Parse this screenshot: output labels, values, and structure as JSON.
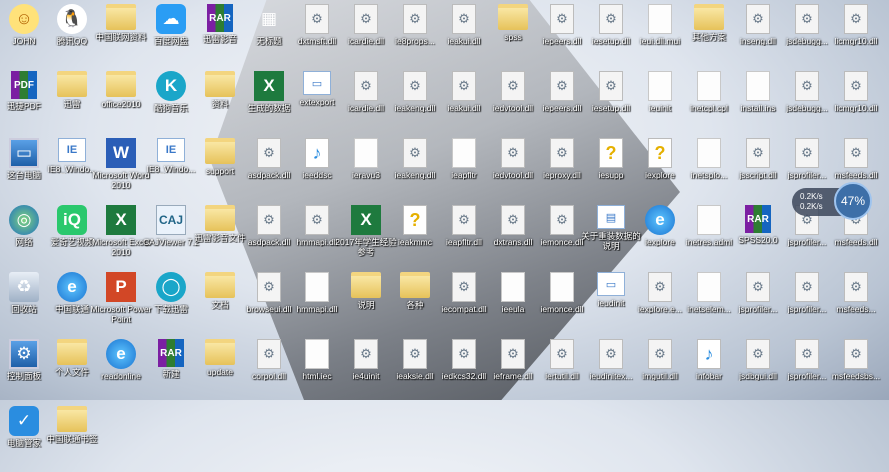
{
  "columns": [
    [
      {
        "label": "JOHN",
        "kind": "user",
        "glyph": "☺",
        "icon": "user-folder-icon"
      },
      {
        "label": "迅捷PDF",
        "kind": "rar",
        "glyph": "PDF",
        "icon": "pdf-converter-icon"
      },
      {
        "label": "这台电脑",
        "kind": "computer",
        "glyph": "▭",
        "icon": "computer-icon"
      },
      {
        "label": "网络",
        "kind": "globe",
        "glyph": "◎",
        "icon": "network-icon"
      },
      {
        "label": "回收站",
        "kind": "trash",
        "glyph": "♻",
        "icon": "recycle-bin-icon"
      },
      {
        "label": "控制面板",
        "kind": "computer",
        "glyph": "⚙",
        "icon": "control-panel-icon"
      },
      {
        "label": "电脑管家",
        "kind": "blue",
        "glyph": "✓",
        "icon": "pc-manager-icon"
      }
    ],
    [
      {
        "label": "腾讯QQ",
        "kind": "qq",
        "glyph": "🐧",
        "icon": "qq-icon"
      },
      {
        "label": "迅雷",
        "kind": "folder",
        "glyph": "",
        "icon": "folder-icon"
      },
      {
        "label": "IE8_Windo...",
        "kind": "exe",
        "glyph": "IE",
        "icon": "installer-icon"
      },
      {
        "label": "爱奇艺视频",
        "kind": "green",
        "glyph": "iQ",
        "icon": "iqiyi-icon"
      },
      {
        "label": "中国联通",
        "kind": "ie",
        "glyph": "e",
        "icon": "ie-icon"
      },
      {
        "label": "个人文件",
        "kind": "folder",
        "glyph": "",
        "icon": "folder-icon"
      },
      {
        "label": "中国联通书签",
        "kind": "folder",
        "glyph": "",
        "icon": "folder-icon"
      }
    ],
    [
      {
        "label": "中国联网资料",
        "kind": "folder",
        "glyph": "",
        "icon": "folder-icon"
      },
      {
        "label": "office2010",
        "kind": "folder",
        "glyph": "",
        "icon": "folder-icon"
      },
      {
        "label": "Microsoft Word 2010",
        "kind": "word",
        "glyph": "W",
        "icon": "word-icon"
      },
      {
        "label": "Microsoft Excel 2010",
        "kind": "excel",
        "glyph": "X",
        "icon": "excel-icon"
      },
      {
        "label": "Microsoft PowerPoint",
        "kind": "ppt",
        "glyph": "P",
        "icon": "powerpoint-icon"
      },
      {
        "label": "readonline",
        "kind": "ie",
        "glyph": "e",
        "icon": "ie-icon"
      }
    ],
    [
      {
        "label": "百度网盘",
        "kind": "cloud",
        "glyph": "☁",
        "icon": "baidu-netdisk-icon"
      },
      {
        "label": "酷狗音乐",
        "kind": "teal",
        "glyph": "K",
        "icon": "kugou-icon"
      },
      {
        "label": "IE8_Windo...",
        "kind": "exe",
        "glyph": "IE",
        "icon": "installer-icon"
      },
      {
        "label": "CAJViewer 7.2",
        "kind": "plain",
        "glyph": "CAJ",
        "icon": "cajviewer-icon"
      },
      {
        "label": "下载迅雷",
        "kind": "teal",
        "glyph": "◯",
        "icon": "download-icon"
      },
      {
        "label": "新建",
        "kind": "rar",
        "glyph": "RAR",
        "icon": "winrar-icon"
      }
    ],
    [
      {
        "label": "迅雷影音",
        "kind": "rar",
        "glyph": "RAR",
        "icon": "winrar-icon"
      },
      {
        "label": "资料",
        "kind": "folder",
        "glyph": "",
        "icon": "folder-icon"
      },
      {
        "label": "support",
        "kind": "folder",
        "glyph": "",
        "icon": "folder-icon"
      },
      {
        "label": "迅雷影音文件",
        "kind": "folder",
        "glyph": "",
        "icon": "folder-icon"
      },
      {
        "label": "文档",
        "kind": "folder",
        "glyph": "",
        "icon": "folder-icon"
      },
      {
        "label": "update",
        "kind": "folder",
        "glyph": "",
        "icon": "folder-icon"
      }
    ],
    [
      {
        "label": "无标题",
        "kind": "app",
        "glyph": "▦",
        "icon": "table-app-icon"
      },
      {
        "label": "生成的数据",
        "kind": "excel",
        "glyph": "X",
        "icon": "excel-file-icon"
      },
      {
        "label": "asdpack.dll",
        "kind": "dll",
        "glyph": "⚙",
        "icon": "dll-file-icon"
      },
      {
        "label": "asdpack.dll",
        "kind": "dll",
        "glyph": "⚙",
        "icon": "dll-file-icon"
      },
      {
        "label": "browseui.dll",
        "kind": "dll",
        "glyph": "⚙",
        "icon": "dll-file-icon"
      },
      {
        "label": "corpol.dll",
        "kind": "dll",
        "glyph": "⚙",
        "icon": "dll-file-icon"
      }
    ],
    [
      {
        "label": "dxtmsft.dll",
        "kind": "dll",
        "glyph": "⚙",
        "icon": "dll-file-icon"
      },
      {
        "label": "extexport",
        "kind": "exe",
        "glyph": "▭",
        "icon": "exe-file-icon"
      },
      {
        "label": "ieeddsc",
        "kind": "media",
        "glyph": "♪",
        "icon": "media-file-icon"
      },
      {
        "label": "hmmapi.dll",
        "kind": "dll",
        "glyph": "⚙",
        "icon": "dll-file-icon"
      },
      {
        "label": "hmmapi.dll",
        "kind": "doc",
        "glyph": "",
        "icon": "file-icon"
      },
      {
        "label": "html.iec",
        "kind": "doc",
        "glyph": "",
        "icon": "file-icon"
      }
    ],
    [
      {
        "label": "icardie.dll",
        "kind": "dll",
        "glyph": "⚙",
        "icon": "dll-file-icon"
      },
      {
        "label": "icardie.dll",
        "kind": "dll",
        "glyph": "⚙",
        "icon": "dll-file-icon"
      },
      {
        "label": "ieravu3",
        "kind": "doc",
        "glyph": "",
        "icon": "file-icon"
      },
      {
        "label": "2017年学生经验参考",
        "kind": "excel",
        "glyph": "X",
        "icon": "excel-file-icon"
      },
      {
        "label": "说明",
        "kind": "folder",
        "glyph": "",
        "icon": "folder-icon"
      },
      {
        "label": "ie4uinit",
        "kind": "dll",
        "glyph": "⚙",
        "icon": "dll-file-icon"
      }
    ],
    [
      {
        "label": "ie8props...",
        "kind": "dll",
        "glyph": "⚙",
        "icon": "dll-file-icon"
      },
      {
        "label": "ieakeng.dll",
        "kind": "dll",
        "glyph": "⚙",
        "icon": "dll-file-icon"
      },
      {
        "label": "ieakeng.dll",
        "kind": "dll",
        "glyph": "⚙",
        "icon": "dll-file-icon"
      },
      {
        "label": "ieakmmc",
        "kind": "help",
        "glyph": "?",
        "icon": "help-file-icon"
      },
      {
        "label": "各种",
        "kind": "folder",
        "glyph": "",
        "icon": "folder-icon"
      },
      {
        "label": "ieaksie.dll",
        "kind": "dll",
        "glyph": "⚙",
        "icon": "dll-file-icon"
      }
    ],
    [
      {
        "label": "ieakui.dll",
        "kind": "dll",
        "glyph": "⚙",
        "icon": "dll-file-icon"
      },
      {
        "label": "ieakui.dll",
        "kind": "dll",
        "glyph": "⚙",
        "icon": "dll-file-icon"
      },
      {
        "label": "ieapfltr",
        "kind": "doc",
        "glyph": "",
        "icon": "file-icon"
      },
      {
        "label": "ieapfltr.dll",
        "kind": "dll",
        "glyph": "⚙",
        "icon": "dll-file-icon"
      },
      {
        "label": "iecompat.dll",
        "kind": "dll",
        "glyph": "⚙",
        "icon": "dll-file-icon"
      },
      {
        "label": "iedkcs32.dll",
        "kind": "dll",
        "glyph": "⚙",
        "icon": "dll-file-icon"
      }
    ],
    [
      {
        "label": "spss",
        "kind": "folder",
        "glyph": "",
        "icon": "folder-icon"
      },
      {
        "label": "iedvtool.dll",
        "kind": "dll",
        "glyph": "⚙",
        "icon": "dll-file-icon"
      },
      {
        "label": "iedvtool.dll",
        "kind": "dll",
        "glyph": "⚙",
        "icon": "dll-file-icon"
      },
      {
        "label": "dxtrans.dll",
        "kind": "dll",
        "glyph": "⚙",
        "icon": "dll-file-icon"
      },
      {
        "label": "ieeula",
        "kind": "doc",
        "glyph": "",
        "icon": "file-icon"
      },
      {
        "label": "ieframe.dll",
        "kind": "dll",
        "glyph": "⚙",
        "icon": "dll-file-icon"
      }
    ],
    [
      {
        "label": "iepeers.dll",
        "kind": "dll",
        "glyph": "⚙",
        "icon": "dll-file-icon"
      },
      {
        "label": "iepeers.dll",
        "kind": "dll",
        "glyph": "⚙",
        "icon": "dll-file-icon"
      },
      {
        "label": "ieproxy.dll",
        "kind": "dll",
        "glyph": "⚙",
        "icon": "dll-file-icon"
      },
      {
        "label": "iemonce.dll",
        "kind": "dll",
        "glyph": "⚙",
        "icon": "dll-file-icon"
      },
      {
        "label": "iemonce.dll",
        "kind": "doc",
        "glyph": "",
        "icon": "file-icon"
      },
      {
        "label": "iertutil.dll",
        "kind": "dll",
        "glyph": "⚙",
        "icon": "dll-file-icon"
      }
    ],
    [
      {
        "label": "iesetup.dll",
        "kind": "dll",
        "glyph": "⚙",
        "icon": "dll-file-icon"
      },
      {
        "label": "iesetup.dll",
        "kind": "dll",
        "glyph": "⚙",
        "icon": "dll-file-icon"
      },
      {
        "label": "iesupp",
        "kind": "help",
        "glyph": "?",
        "icon": "help-file-icon"
      },
      {
        "label": "关于重装数据的说明",
        "kind": "exe",
        "glyph": "▤",
        "icon": "document-file-icon"
      },
      {
        "label": "ieudinit",
        "kind": "exe",
        "glyph": "▭",
        "icon": "exe-file-icon"
      },
      {
        "label": "ieudinitex...",
        "kind": "dll",
        "glyph": "⚙",
        "icon": "dll-file-icon"
      }
    ],
    [
      {
        "label": "ieui.dll.mui",
        "kind": "doc",
        "glyph": "",
        "icon": "file-icon"
      },
      {
        "label": "ieuinit",
        "kind": "doc",
        "glyph": "",
        "icon": "file-icon"
      },
      {
        "label": "iexplore",
        "kind": "help",
        "glyph": "?",
        "icon": "help-file-icon"
      },
      {
        "label": "iexplore",
        "kind": "ie",
        "glyph": "e",
        "icon": "ie-icon"
      },
      {
        "label": "iexplore.e...",
        "kind": "dll",
        "glyph": "⚙",
        "icon": "dll-file-icon"
      },
      {
        "label": "imgutil.dll",
        "kind": "dll",
        "glyph": "⚙",
        "icon": "dll-file-icon"
      }
    ],
    [
      {
        "label": "其他方案",
        "kind": "folder",
        "glyph": "",
        "icon": "folder-icon"
      },
      {
        "label": "inetcpl.cpl",
        "kind": "doc",
        "glyph": "",
        "icon": "file-icon"
      },
      {
        "label": "inetsplo...",
        "kind": "doc",
        "glyph": "",
        "icon": "file-icon"
      },
      {
        "label": "inetres.adml",
        "kind": "doc",
        "glyph": "",
        "icon": "file-icon"
      },
      {
        "label": "inetselem...",
        "kind": "doc",
        "glyph": "",
        "icon": "file-icon"
      },
      {
        "label": "infobar",
        "kind": "media",
        "glyph": "♪",
        "icon": "media-file-icon"
      }
    ],
    [
      {
        "label": "inseng.dll",
        "kind": "dll",
        "glyph": "⚙",
        "icon": "dll-file-icon"
      },
      {
        "label": "install.ins",
        "kind": "doc",
        "glyph": "",
        "icon": "file-icon"
      },
      {
        "label": "jsscript.dll",
        "kind": "dll",
        "glyph": "⚙",
        "icon": "dll-file-icon"
      },
      {
        "label": "SPSS20.0",
        "kind": "rar",
        "glyph": "RAR",
        "icon": "winrar-icon"
      },
      {
        "label": "jsprofiler...",
        "kind": "dll",
        "glyph": "⚙",
        "icon": "dll-file-icon"
      },
      {
        "label": "jsdbgui.dll",
        "kind": "dll",
        "glyph": "⚙",
        "icon": "dll-file-icon"
      }
    ],
    [
      {
        "label": "jsdebugg...",
        "kind": "dll",
        "glyph": "⚙",
        "icon": "dll-file-icon"
      },
      {
        "label": "jsdebugg...",
        "kind": "dll",
        "glyph": "⚙",
        "icon": "dll-file-icon"
      },
      {
        "label": "jsprofiler...",
        "kind": "dll",
        "glyph": "⚙",
        "icon": "dll-file-icon"
      },
      {
        "label": "jsprofiler...",
        "kind": "dll",
        "glyph": "⚙",
        "icon": "dll-file-icon"
      },
      {
        "label": "jsprofiler...",
        "kind": "dll",
        "glyph": "⚙",
        "icon": "dll-file-icon"
      },
      {
        "label": "jsprofiler...",
        "kind": "dll",
        "glyph": "⚙",
        "icon": "dll-file-icon"
      }
    ],
    [
      {
        "label": "licmgr10.dll",
        "kind": "dll",
        "glyph": "⚙",
        "icon": "dll-file-icon"
      },
      {
        "label": "licmgr10.dll",
        "kind": "dll",
        "glyph": "⚙",
        "icon": "dll-file-icon"
      },
      {
        "label": "msfeeds.dll",
        "kind": "dll",
        "glyph": "⚙",
        "icon": "dll-file-icon"
      },
      {
        "label": "msfeeds.dll",
        "kind": "dll",
        "glyph": "⚙",
        "icon": "dll-file-icon"
      },
      {
        "label": "msfeeds...",
        "kind": "dll",
        "glyph": "⚙",
        "icon": "dll-file-icon"
      },
      {
        "label": "msfeedsbs...",
        "kind": "dll",
        "glyph": "⚙",
        "icon": "dll-file-icon"
      }
    ]
  ],
  "speed_widget": {
    "upload": "0.2K/s",
    "download": "0.2K/s",
    "usage": "47%"
  }
}
